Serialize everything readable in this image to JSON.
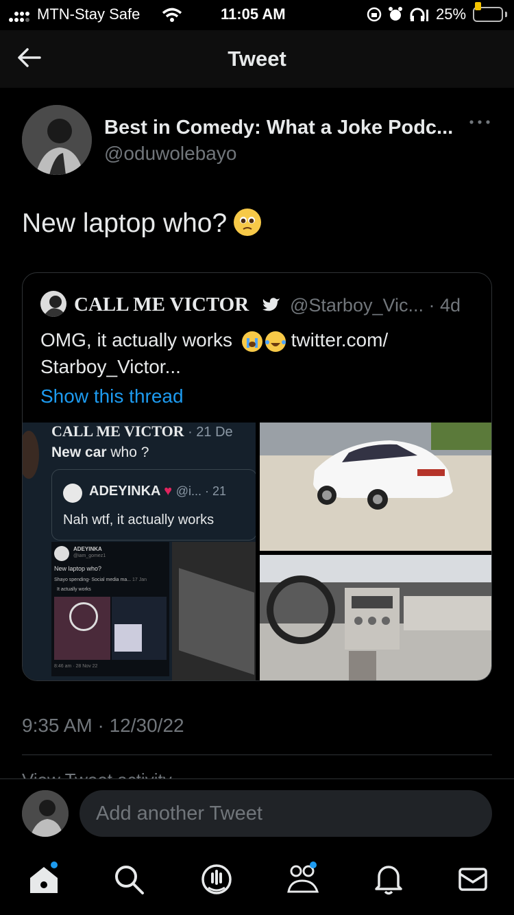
{
  "status_bar": {
    "carrier": "MTN-Stay Safe",
    "time": "11:05 AM",
    "battery": "25%",
    "battery_level": 0.25,
    "icons": [
      "signal-icon",
      "wifi-icon",
      "orientation-lock-icon",
      "alarm-icon",
      "headphones-icon",
      "battery-icon"
    ]
  },
  "header": {
    "title": "Tweet",
    "back_icon": "back-arrow-icon"
  },
  "tweet": {
    "author_name": "Best in Comedy: What a Joke Podc...",
    "author_handle": "@oduwolebayo",
    "text": "New laptop who?",
    "emoji": "pleading-face-emoji",
    "timestamp": "9:35 AM · 12/30/22",
    "activity_label": "View Tweet activity"
  },
  "quoted_tweet": {
    "name": "CALL ME VICTOR",
    "verified_icon": "twitter-bird-icon",
    "handle_time": "@Starboy_Vic... · 4d",
    "text_part1": "OMG, it actually works",
    "text_part2": "twitter.com/",
    "text_line2": "Starboy_Victor...",
    "show_thread": "Show this thread",
    "emojis": [
      "crying-face-emoji",
      "laughing-tears-emoji"
    ]
  },
  "media": {
    "screenshot": {
      "name": "CALL ME VICTOR",
      "meta": "· 21 De",
      "text_bold": "New car",
      "text_rest": " who ?",
      "inner_name": "ADEYINKA",
      "inner_meta": "@i...  · 21",
      "inner_text": "Nah wtf, it actually works",
      "mini_name": "ADEYINKA",
      "mini_handle": "@iam_gomez1",
      "mini_text": "New laptop who?",
      "mini_quote": "Shayo spending- Social media ma...",
      "mini_quote_date": "17 Jan",
      "mini_quote_text": "It actually works",
      "mini_footer": "8:46 am · 28 Nov 22"
    },
    "photo_exterior": "white-sedan-photo",
    "photo_interior": "car-interior-photo"
  },
  "reply": {
    "placeholder": "Add another Tweet"
  },
  "tabs": [
    {
      "icon": "home-icon",
      "badge": true
    },
    {
      "icon": "search-icon",
      "badge": false
    },
    {
      "icon": "spaces-icon",
      "badge": false
    },
    {
      "icon": "communities-icon",
      "badge": true
    },
    {
      "icon": "notifications-icon",
      "badge": false
    },
    {
      "icon": "messages-icon",
      "badge": false
    }
  ],
  "colors": {
    "background": "#000000",
    "link": "#1d9bf0",
    "secondary_text": "#71767b",
    "battery": "#f5c400"
  }
}
